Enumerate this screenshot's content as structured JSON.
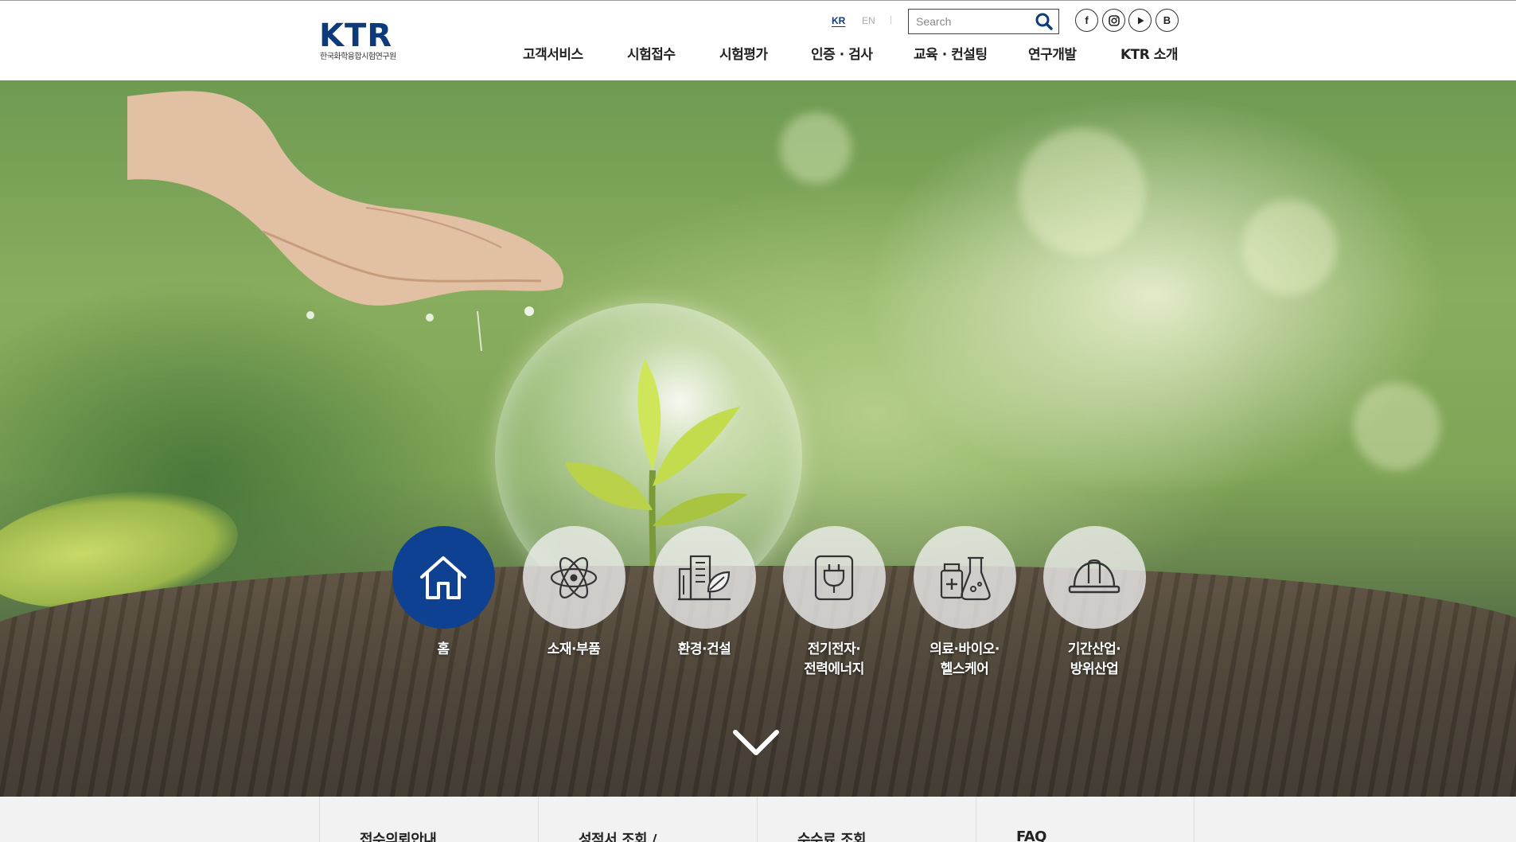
{
  "brand": {
    "logo_text": "KTR",
    "logo_subtitle": "한국화학융합시험연구원",
    "primary_color": "#0f4192"
  },
  "header": {
    "lang_kr": "KR",
    "lang_en": "EN",
    "lang_separator": "|",
    "search_placeholder": "Search",
    "social": [
      {
        "icon": "facebook-icon",
        "label": "f"
      },
      {
        "icon": "instagram-icon",
        "label": ""
      },
      {
        "icon": "youtube-icon",
        "label": ""
      },
      {
        "icon": "blog-icon",
        "label": "B"
      }
    ]
  },
  "nav": {
    "items": [
      {
        "label": "고객서비스"
      },
      {
        "label": "시험접수"
      },
      {
        "label": "시험평가"
      },
      {
        "label": "인증 · 검사"
      },
      {
        "label": "교육 · 컨설팅"
      },
      {
        "label": "연구개발"
      },
      {
        "label": "KTR 소개"
      }
    ]
  },
  "hero": {
    "categories": [
      {
        "label": "홈",
        "icon": "home-icon",
        "active": true
      },
      {
        "label": "소재·부품",
        "icon": "atom-icon",
        "active": false
      },
      {
        "label": "환경·건설",
        "icon": "building-leaf-icon",
        "active": false
      },
      {
        "label": "전기전자·\n전력에너지",
        "icon": "plug-icon",
        "active": false
      },
      {
        "label": "의료·바이오·\n헬스케어",
        "icon": "medicine-flask-icon",
        "active": false
      },
      {
        "label": "기간산업·\n방위산업",
        "icon": "hardhat-icon",
        "active": false
      }
    ],
    "scroll_icon": "chevron-down-icon"
  },
  "quick_links": [
    {
      "label": "접수의뢰안내"
    },
    {
      "label": "성적서 조회 /"
    },
    {
      "label": "수수료 조회"
    },
    {
      "label": "FAQ"
    }
  ]
}
